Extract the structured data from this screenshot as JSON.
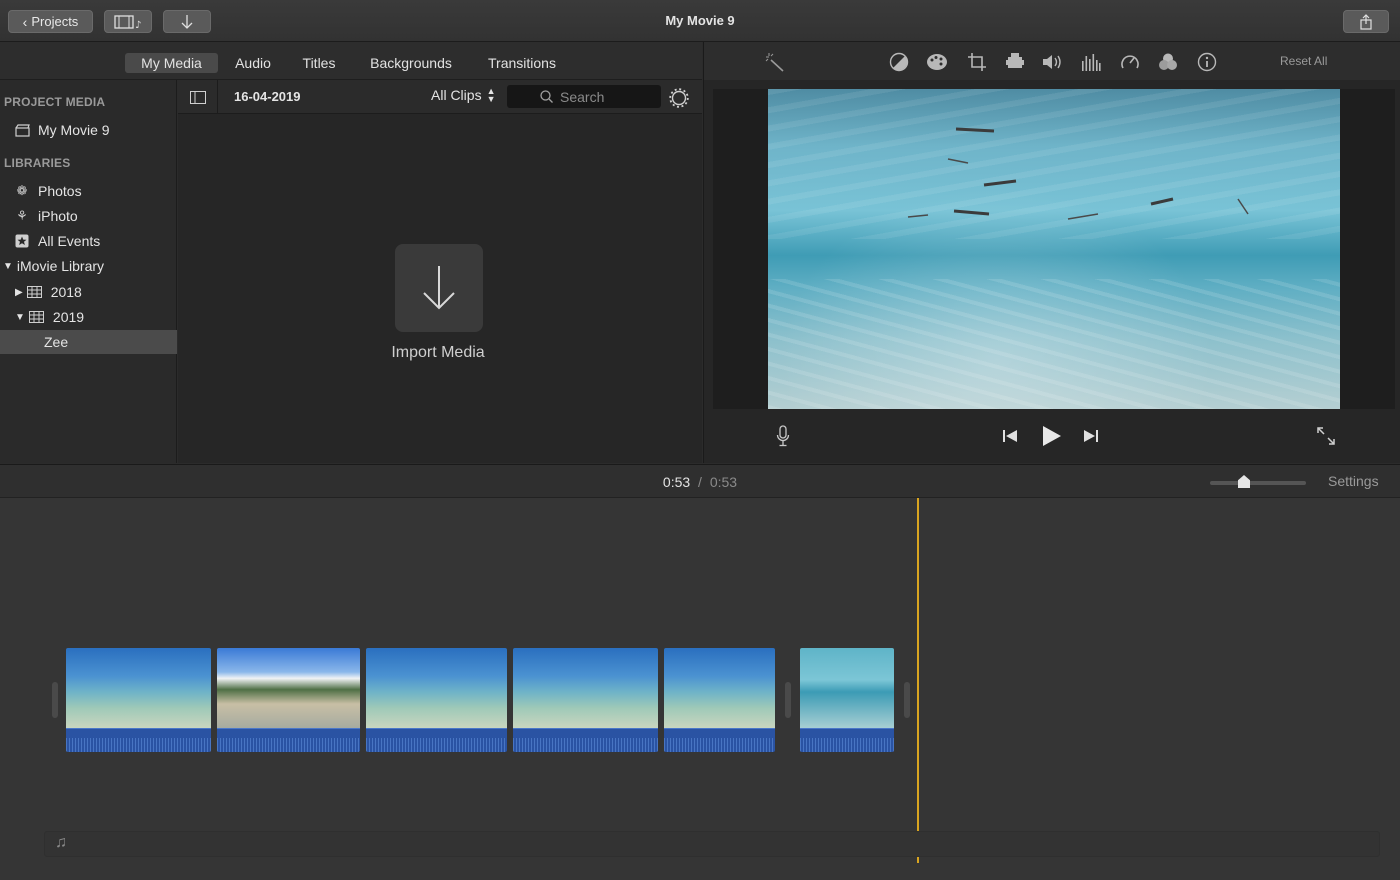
{
  "titlebar": {
    "projects_label": "Projects",
    "title": "My Movie 9"
  },
  "tabs": [
    "My Media",
    "Audio",
    "Titles",
    "Backgrounds",
    "Transitions"
  ],
  "sidebar": {
    "project_media_heading": "PROJECT MEDIA",
    "project_item": "My Movie 9",
    "libraries_heading": "LIBRARIES",
    "items": [
      "Photos",
      "iPhoto",
      "All Events",
      "iMovie Library",
      "2018",
      "2019",
      "Zee"
    ]
  },
  "browser": {
    "date": "16-04-2019",
    "filter": "All Clips",
    "search_placeholder": "Search",
    "import_label": "Import Media"
  },
  "viewer": {
    "reset_all": "Reset All"
  },
  "timeline": {
    "current_time": "0:53",
    "separator": "/",
    "total_time": "0:53",
    "settings_label": "Settings",
    "zoom_level": 0.35
  },
  "colors": {
    "playhead": "#d9a520",
    "audio_track": "#2a53a3"
  }
}
